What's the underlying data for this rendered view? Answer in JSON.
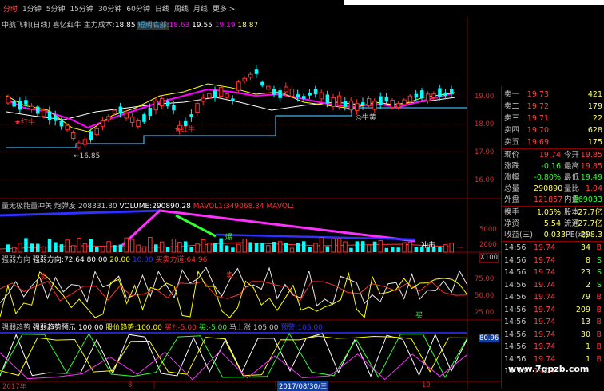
{
  "toolbar": {
    "tabs": [
      "分时",
      "1分钟",
      "5分钟",
      "15分钟",
      "30分钟",
      "60分钟",
      "日线",
      "周线",
      "月线",
      "更多 >"
    ]
  },
  "main_chart": {
    "title": "中航飞机(日线) 喜忆红牛",
    "main_cost_label": "主力成本:",
    "main_cost_value": "18.85",
    "short_bottom_label": "短期底部:",
    "short_bottom_value": "18.63",
    "v1": "19.55",
    "v2": "19.19",
    "v3": "18.87",
    "low_marker": "←16.85",
    "tag_red_bull_1": "★红牛",
    "tag_red_bull_2": "★红牛",
    "tag_bull_cross": "◎牛黄",
    "axis": [
      "19.00",
      "18.00",
      "17.00",
      "16.00"
    ],
    "colors": {
      "up": "#ff3030",
      "down": "#00ffff",
      "ma_white": "#ffffff",
      "ma_yellow": "#ffff00",
      "ma_magenta": "#ff00ff",
      "support": "#3cb4f0"
    }
  },
  "volume_panel": {
    "title": "量无极能量冲关",
    "power_label": "炮弹度:",
    "power_value": "208331.80",
    "volume_label": "VOLUME:",
    "volume_value": "290890.28",
    "mavol1_label": "MAVOL1:",
    "mavol1_value": "349068.34",
    "mavol2_label": "MAVOL:",
    "tag_blast": "爆",
    "tag_attack": "冲击",
    "axis": [
      "5000",
      "2000"
    ],
    "unit": "X100"
  },
  "strength_panel": {
    "title": "强弱方向",
    "dir_label": "强弱方向:",
    "dir_value": "72.64",
    "v2": "80.00",
    "v3": "20.00",
    "v4": "10.00",
    "buy_power_label": "买卖力道:",
    "buy_power_value": "64.96",
    "tag_sell": "卖",
    "tag_buy": "买",
    "axis": [
      "75.00",
      "50.00",
      "25.00"
    ]
  },
  "trend_panel": {
    "title": "强弱趋势",
    "trend_label": "强弱趋势预示:",
    "trend_value": "100.00",
    "price_trend_label": "股价趋势:",
    "price_trend_value": "100.00",
    "buy_label": "买?:",
    "buy_value": "-5.00",
    "buy2_label": "买:",
    "buy2_value": "-5.00",
    "rise_label": "马上涨:",
    "rise_value": "105.00",
    "warn_label": "预警:",
    "warn_value": "105.00",
    "tag_value": "80.96"
  },
  "date_axis": {
    "labels": [
      "2017年",
      "8",
      "2017/08/30/三",
      "10"
    ]
  },
  "quotes": {
    "asks": [
      {
        "label": "卖一",
        "price": "19.73",
        "vol": "421"
      },
      {
        "label": "卖二",
        "price": "19.72",
        "vol": "179"
      },
      {
        "label": "卖三",
        "price": "19.71",
        "vol": "22"
      },
      {
        "label": "卖四",
        "price": "19.70",
        "vol": "628"
      },
      {
        "label": "卖五",
        "price": "19.69",
        "vol": "175"
      }
    ],
    "info": [
      {
        "l1": "现价",
        "v1": "19.74",
        "l2": "今开",
        "v2": "19.85"
      },
      {
        "l1": "涨跌",
        "v1": "-0.16",
        "l2": "最高",
        "v2": "19.85"
      },
      {
        "l1": "涨幅",
        "v1": "-0.80%",
        "l2": "最低",
        "v2": "19.49"
      },
      {
        "l1": "总量",
        "v1": "290890",
        "l2": "量比",
        "v2": "1.04"
      },
      {
        "l1": "外盘",
        "v1": "121857",
        "l2": "内盘",
        "v2": "169033"
      }
    ],
    "info2": [
      {
        "l1": "换手",
        "v1": "1.05%",
        "l2": "股本",
        "v2": "27.7亿"
      },
      {
        "l1": "净资",
        "v1": "5.54",
        "l2": "流通",
        "v2": "27.7亿"
      },
      {
        "l1": "收益(三)",
        "v1": "0.033",
        "l2": "PE(动)",
        "v2": "298.3"
      }
    ],
    "ticks": [
      {
        "time": "14:56",
        "price": "19.74",
        "vol": "34",
        "bs": "B"
      },
      {
        "time": "14:56",
        "price": "19.74",
        "vol": "8",
        "bs": "S"
      },
      {
        "time": "14:56",
        "price": "19.74",
        "vol": "23",
        "bs": "S"
      },
      {
        "time": "14:56",
        "price": "19.74",
        "vol": "2",
        "bs": "S"
      },
      {
        "time": "14:56",
        "price": "19.74",
        "vol": "79",
        "bs": "B"
      },
      {
        "time": "14:56",
        "price": "19.74",
        "vol": "209",
        "bs": "B"
      },
      {
        "time": "14:56",
        "price": "19.74",
        "vol": "13",
        "bs": "B"
      },
      {
        "time": "14:56",
        "price": "19.74",
        "vol": "30",
        "bs": "B"
      },
      {
        "time": "14:56",
        "price": "19.74",
        "vol": "1",
        "bs": "B"
      },
      {
        "time": "14:56",
        "price": "19.74",
        "vol": "1",
        "bs": "B"
      },
      {
        "time": "14:56",
        "price": "19.74",
        "vol": "",
        "bs": ""
      }
    ]
  },
  "watermark": "www.7gpzb.com"
}
